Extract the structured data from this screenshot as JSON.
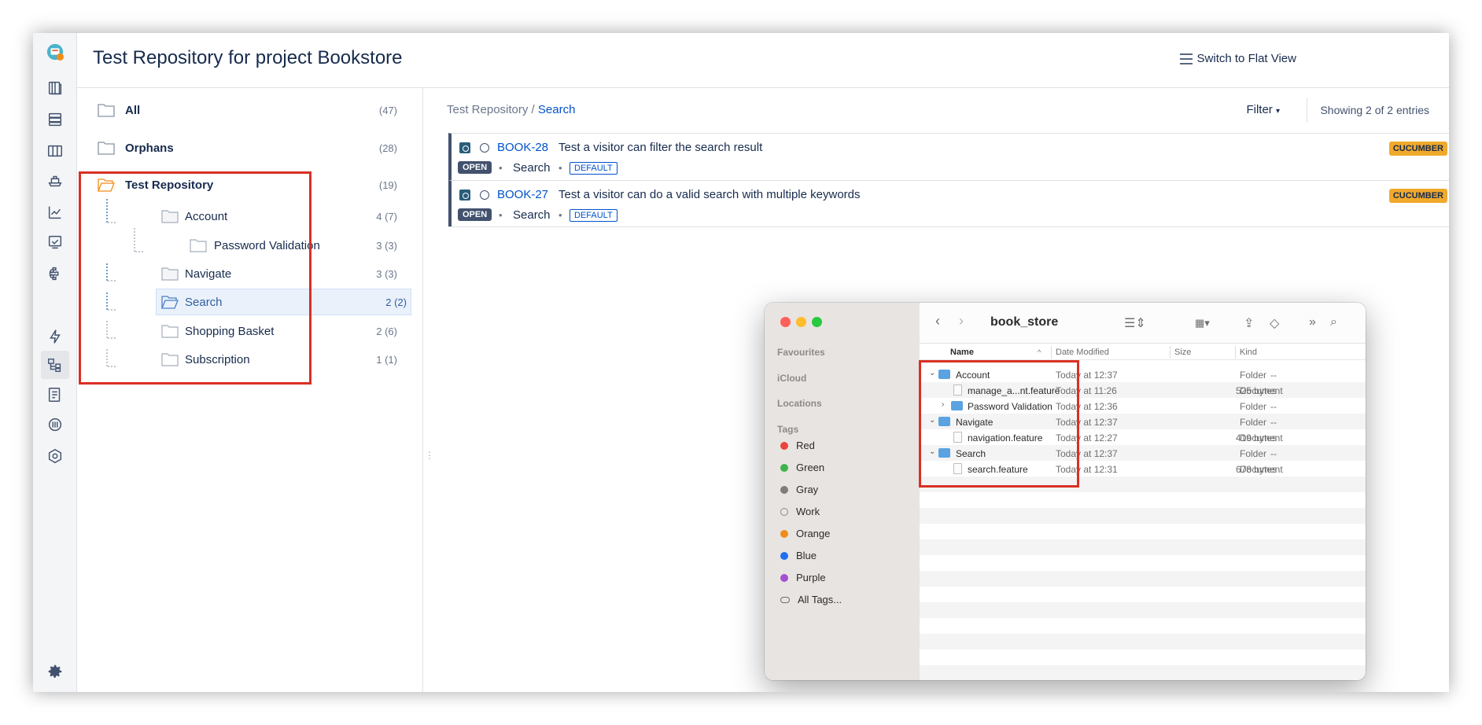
{
  "header": {
    "title": "Test Repository for project Bookstore",
    "flat_view_label": "Switch to Flat View"
  },
  "tree": {
    "items": [
      {
        "label": "All",
        "count": "(47)"
      },
      {
        "label": "Orphans",
        "count": "(28)"
      },
      {
        "label": "Test Repository",
        "count": "(19)"
      },
      {
        "label": "Account",
        "count": "4 (7)"
      },
      {
        "label": "Password Validation",
        "count": "3 (3)"
      },
      {
        "label": "Navigate",
        "count": "3 (3)"
      },
      {
        "label": "Search",
        "count": "2 (2)"
      },
      {
        "label": "Shopping Basket",
        "count": "2 (6)"
      },
      {
        "label": "Subscription",
        "count": "1 (1)"
      }
    ]
  },
  "breadcrumb": {
    "root": "Test Repository",
    "sep": " / ",
    "current": "Search"
  },
  "toolbar": {
    "filter_label": "Filter",
    "showing": "Showing 2 of 2 entries"
  },
  "issues": [
    {
      "key": "BOOK-28",
      "summary": "Test a visitor can filter the search result",
      "status": "OPEN",
      "folder": "Search",
      "env": "DEFAULT",
      "type": "CUCUMBER"
    },
    {
      "key": "BOOK-27",
      "summary": "Test a visitor can do a valid search with multiple keywords",
      "status": "OPEN",
      "folder": "Search",
      "env": "DEFAULT",
      "type": "CUCUMBER"
    }
  ],
  "finder": {
    "title": "book_store",
    "sidebar": {
      "favourites": "Favourites",
      "icloud": "iCloud",
      "locations": "Locations",
      "tags_header": "Tags",
      "tags": [
        {
          "name": "Red",
          "color": "#e8453c"
        },
        {
          "name": "Green",
          "color": "#3bb44a"
        },
        {
          "name": "Gray",
          "color": "#7d7d7d"
        },
        {
          "name": "Work",
          "color": ""
        },
        {
          "name": "Orange",
          "color": "#f08c1a"
        },
        {
          "name": "Blue",
          "color": "#1f6ff2"
        },
        {
          "name": "Purple",
          "color": "#a54fd2"
        }
      ],
      "all_tags": "All Tags..."
    },
    "columns": {
      "name": "Name",
      "date": "Date Modified",
      "size": "Size",
      "kind": "Kind"
    },
    "rows": [
      {
        "name": "Account",
        "date": "Today at 12:37",
        "size": "--",
        "kind": "Folder"
      },
      {
        "name": "manage_a...nt.feature",
        "date": "Today at 11:26",
        "size": "525 bytes",
        "kind": "Document"
      },
      {
        "name": "Password Validation",
        "date": "Today at 12:36",
        "size": "--",
        "kind": "Folder"
      },
      {
        "name": "Navigate",
        "date": "Today at 12:37",
        "size": "--",
        "kind": "Folder"
      },
      {
        "name": "navigation.feature",
        "date": "Today at 12:27",
        "size": "419 bytes",
        "kind": "Document"
      },
      {
        "name": "Search",
        "date": "Today at 12:37",
        "size": "--",
        "kind": "Folder"
      },
      {
        "name": "search.feature",
        "date": "Today at 12:31",
        "size": "678 bytes",
        "kind": "Document"
      }
    ]
  }
}
